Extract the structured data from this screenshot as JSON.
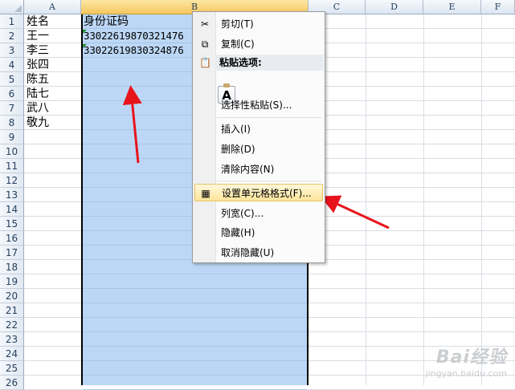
{
  "columns": [
    "A",
    "B",
    "C",
    "D",
    "E",
    "F"
  ],
  "rows": [
    "1",
    "2",
    "3",
    "4",
    "5",
    "6",
    "7",
    "8",
    "9",
    "10",
    "11",
    "12",
    "13",
    "14",
    "15",
    "16",
    "17",
    "18",
    "19",
    "20",
    "21",
    "22",
    "23",
    "24",
    "25",
    "26"
  ],
  "cells": {
    "A1": "姓名",
    "A2": "王一",
    "A3": "李三",
    "A4": "张四",
    "A5": "陈五",
    "A6": "陆七",
    "A7": "武八",
    "A8": "敬九",
    "B1": "身份证码",
    "B2": "33022619870321476",
    "B3": "33022619830324876"
  },
  "context_menu": {
    "cut": "剪切(T)",
    "copy": "复制(C)",
    "paste_options_header": "粘贴选项:",
    "paste_button": "A",
    "paste_special": "选择性粘贴(S)...",
    "insert": "插入(I)",
    "delete": "删除(D)",
    "clear_contents": "清除内容(N)",
    "format_cells": "设置单元格格式(F)...",
    "column_width": "列宽(C)...",
    "hide": "隐藏(H)",
    "unhide": "取消隐藏(U)"
  },
  "watermark": {
    "logo": "Bai经验",
    "url": "jingyan.baidu.com"
  },
  "colors": {
    "selection": "#bcd7f5",
    "highlight": "#ffe59a",
    "arrow": "#e8141c"
  }
}
